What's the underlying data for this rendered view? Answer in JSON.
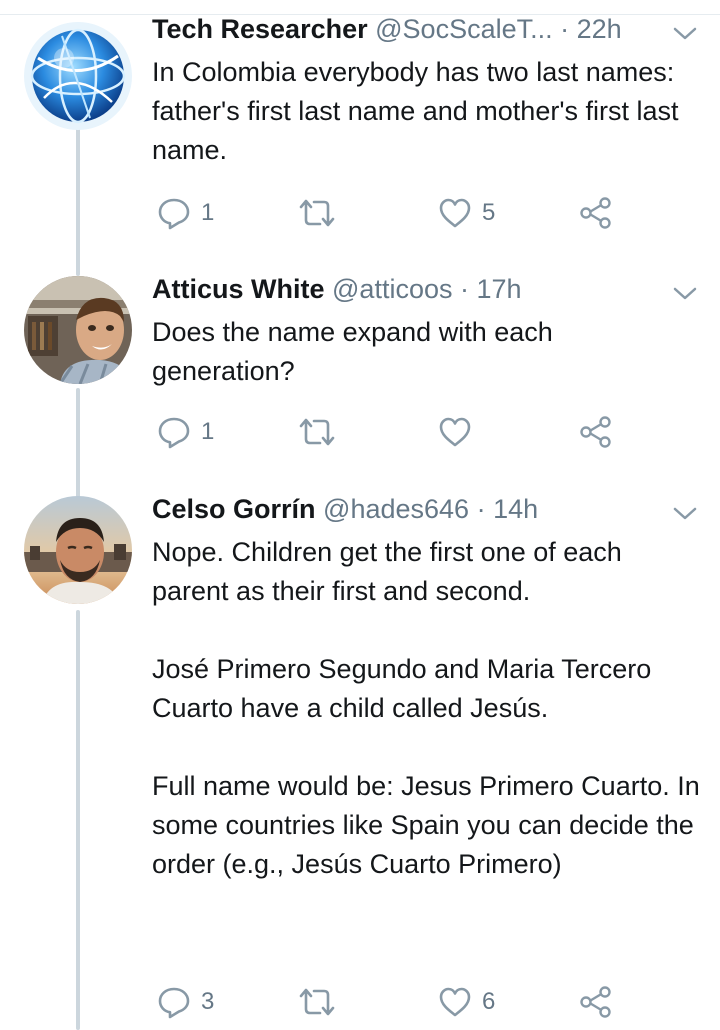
{
  "colors": {
    "text": "#14171a",
    "secondary": "#657786",
    "icon": "#8899a6",
    "thread_line": "#ccd6dd"
  },
  "tweets": [
    {
      "avatar_icon": "globe-icon",
      "name": "Tech Researcher",
      "handle": "@SocScaleT...",
      "time": "· 22h",
      "text": "In Colombia everybody has two last names: father's first last name and mother's first last name.",
      "replies": "1",
      "retweets": "",
      "likes": "5"
    },
    {
      "avatar_icon": "user-photo",
      "name": "Atticus White",
      "handle": "@atticoos",
      "time": "· 17h",
      "text": "Does the name expand with each generation?",
      "replies": "1",
      "retweets": "",
      "likes": ""
    },
    {
      "avatar_icon": "user-photo",
      "name": "Celso Gorrín",
      "handle": "@hades646",
      "time": "· 14h",
      "text": "Nope. Children get the first one of each parent as their first and second.\n\nJosé Primero Segundo and Maria Tercero Cuarto have a child called Jesús.\n\nFull name would be: Jesus Primero Cuarto. In some countries like Spain you can decide the order (e.g., Jesús Cuarto Primero)",
      "replies": "3",
      "retweets": "",
      "likes": "6"
    }
  ]
}
